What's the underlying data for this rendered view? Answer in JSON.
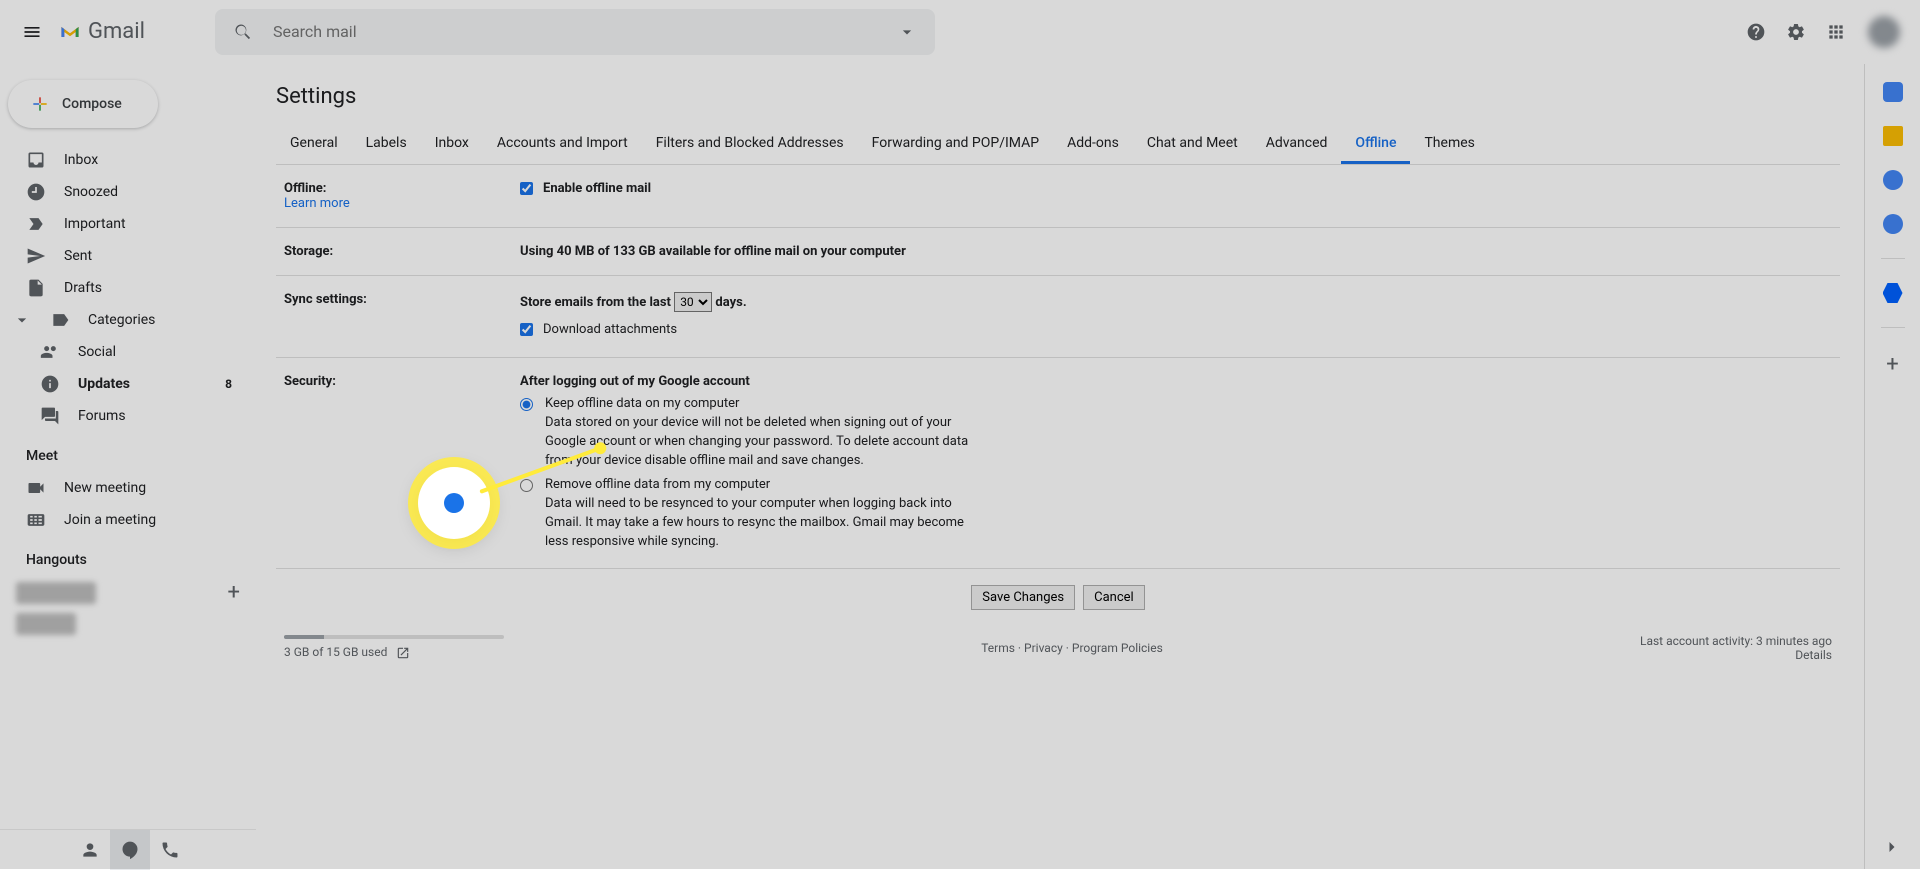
{
  "header": {
    "logo_text": "Gmail",
    "search_placeholder": "Search mail"
  },
  "compose_label": "Compose",
  "nav": {
    "inbox": "Inbox",
    "snoozed": "Snoozed",
    "important": "Important",
    "sent": "Sent",
    "drafts": "Drafts",
    "categories": "Categories",
    "social": "Social",
    "updates": "Updates",
    "updates_count": "8",
    "forums": "Forums"
  },
  "meet_title": "Meet",
  "meet": {
    "new": "New meeting",
    "join": "Join a meeting"
  },
  "hangouts_title": "Hangouts",
  "settings_title": "Settings",
  "tabs": {
    "general": "General",
    "labels": "Labels",
    "inbox": "Inbox",
    "accounts": "Accounts and Import",
    "filters": "Filters and Blocked Addresses",
    "forwarding": "Forwarding and POP/IMAP",
    "addons": "Add-ons",
    "chat": "Chat and Meet",
    "advanced": "Advanced",
    "offline": "Offline",
    "themes": "Themes"
  },
  "offline": {
    "label": "Offline:",
    "learn_more": "Learn more",
    "enable": "Enable offline mail"
  },
  "storage": {
    "label": "Storage:",
    "text": "Using 40 MB of 133 GB available for offline mail on your computer"
  },
  "sync": {
    "label": "Sync settings:",
    "pre": "Store emails from the last",
    "days_value": "30",
    "post": "days.",
    "download": "Download attachments"
  },
  "security": {
    "label": "Security:",
    "heading": "After logging out of my Google account",
    "keep_label": "Keep offline data on my computer",
    "keep_hint": "Data stored on your device will not be deleted when signing out of your Google account or when changing your password. To delete account data from your device disable offline mail and save changes.",
    "remove_label": "Remove offline data from my computer",
    "remove_hint": "Data will need to be resynced to your computer when logging back into Gmail. It may take a few hours to resync the mailbox. Gmail may become less responsive while syncing."
  },
  "buttons": {
    "save": "Save Changes",
    "cancel": "Cancel"
  },
  "footer": {
    "storage": "3 GB of 15 GB used",
    "terms": "Terms",
    "privacy": "Privacy",
    "policies": "Program Policies",
    "activity": "Last account activity: 3 minutes ago",
    "details": "Details"
  }
}
